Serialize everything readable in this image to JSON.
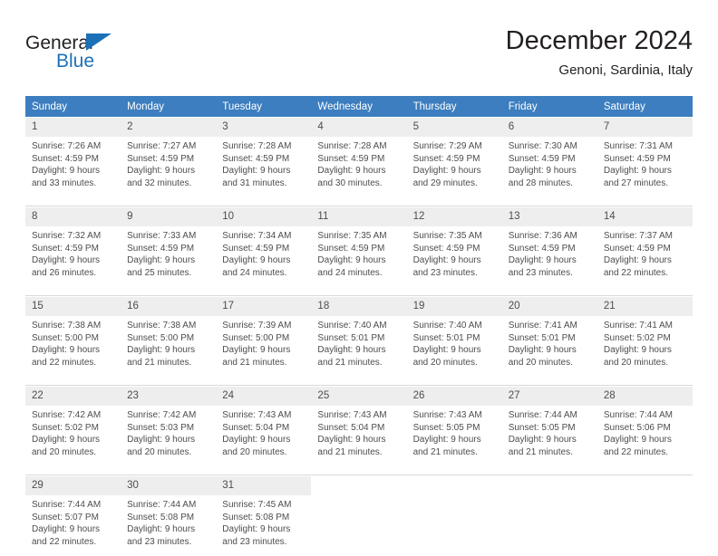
{
  "logo": {
    "word1": "General",
    "word2": "Blue",
    "triangle_color": "#1c70b8",
    "text_color": "#231f20"
  },
  "header": {
    "title": "December 2024",
    "subtitle": "Genoni, Sardinia, Italy"
  },
  "calendar": {
    "header_bg": "#3c7ebf",
    "header_text_color": "#ffffff",
    "daynum_bg": "#eeeeee",
    "weekdays": [
      "Sunday",
      "Monday",
      "Tuesday",
      "Wednesday",
      "Thursday",
      "Friday",
      "Saturday"
    ],
    "weeks": [
      [
        {
          "day": "1",
          "sunrise": "Sunrise: 7:26 AM",
          "sunset": "Sunset: 4:59 PM",
          "daylight1": "Daylight: 9 hours",
          "daylight2": "and 33 minutes."
        },
        {
          "day": "2",
          "sunrise": "Sunrise: 7:27 AM",
          "sunset": "Sunset: 4:59 PM",
          "daylight1": "Daylight: 9 hours",
          "daylight2": "and 32 minutes."
        },
        {
          "day": "3",
          "sunrise": "Sunrise: 7:28 AM",
          "sunset": "Sunset: 4:59 PM",
          "daylight1": "Daylight: 9 hours",
          "daylight2": "and 31 minutes."
        },
        {
          "day": "4",
          "sunrise": "Sunrise: 7:28 AM",
          "sunset": "Sunset: 4:59 PM",
          "daylight1": "Daylight: 9 hours",
          "daylight2": "and 30 minutes."
        },
        {
          "day": "5",
          "sunrise": "Sunrise: 7:29 AM",
          "sunset": "Sunset: 4:59 PM",
          "daylight1": "Daylight: 9 hours",
          "daylight2": "and 29 minutes."
        },
        {
          "day": "6",
          "sunrise": "Sunrise: 7:30 AM",
          "sunset": "Sunset: 4:59 PM",
          "daylight1": "Daylight: 9 hours",
          "daylight2": "and 28 minutes."
        },
        {
          "day": "7",
          "sunrise": "Sunrise: 7:31 AM",
          "sunset": "Sunset: 4:59 PM",
          "daylight1": "Daylight: 9 hours",
          "daylight2": "and 27 minutes."
        }
      ],
      [
        {
          "day": "8",
          "sunrise": "Sunrise: 7:32 AM",
          "sunset": "Sunset: 4:59 PM",
          "daylight1": "Daylight: 9 hours",
          "daylight2": "and 26 minutes."
        },
        {
          "day": "9",
          "sunrise": "Sunrise: 7:33 AM",
          "sunset": "Sunset: 4:59 PM",
          "daylight1": "Daylight: 9 hours",
          "daylight2": "and 25 minutes."
        },
        {
          "day": "10",
          "sunrise": "Sunrise: 7:34 AM",
          "sunset": "Sunset: 4:59 PM",
          "daylight1": "Daylight: 9 hours",
          "daylight2": "and 24 minutes."
        },
        {
          "day": "11",
          "sunrise": "Sunrise: 7:35 AM",
          "sunset": "Sunset: 4:59 PM",
          "daylight1": "Daylight: 9 hours",
          "daylight2": "and 24 minutes."
        },
        {
          "day": "12",
          "sunrise": "Sunrise: 7:35 AM",
          "sunset": "Sunset: 4:59 PM",
          "daylight1": "Daylight: 9 hours",
          "daylight2": "and 23 minutes."
        },
        {
          "day": "13",
          "sunrise": "Sunrise: 7:36 AM",
          "sunset": "Sunset: 4:59 PM",
          "daylight1": "Daylight: 9 hours",
          "daylight2": "and 23 minutes."
        },
        {
          "day": "14",
          "sunrise": "Sunrise: 7:37 AM",
          "sunset": "Sunset: 4:59 PM",
          "daylight1": "Daylight: 9 hours",
          "daylight2": "and 22 minutes."
        }
      ],
      [
        {
          "day": "15",
          "sunrise": "Sunrise: 7:38 AM",
          "sunset": "Sunset: 5:00 PM",
          "daylight1": "Daylight: 9 hours",
          "daylight2": "and 22 minutes."
        },
        {
          "day": "16",
          "sunrise": "Sunrise: 7:38 AM",
          "sunset": "Sunset: 5:00 PM",
          "daylight1": "Daylight: 9 hours",
          "daylight2": "and 21 minutes."
        },
        {
          "day": "17",
          "sunrise": "Sunrise: 7:39 AM",
          "sunset": "Sunset: 5:00 PM",
          "daylight1": "Daylight: 9 hours",
          "daylight2": "and 21 minutes."
        },
        {
          "day": "18",
          "sunrise": "Sunrise: 7:40 AM",
          "sunset": "Sunset: 5:01 PM",
          "daylight1": "Daylight: 9 hours",
          "daylight2": "and 21 minutes."
        },
        {
          "day": "19",
          "sunrise": "Sunrise: 7:40 AM",
          "sunset": "Sunset: 5:01 PM",
          "daylight1": "Daylight: 9 hours",
          "daylight2": "and 20 minutes."
        },
        {
          "day": "20",
          "sunrise": "Sunrise: 7:41 AM",
          "sunset": "Sunset: 5:01 PM",
          "daylight1": "Daylight: 9 hours",
          "daylight2": "and 20 minutes."
        },
        {
          "day": "21",
          "sunrise": "Sunrise: 7:41 AM",
          "sunset": "Sunset: 5:02 PM",
          "daylight1": "Daylight: 9 hours",
          "daylight2": "and 20 minutes."
        }
      ],
      [
        {
          "day": "22",
          "sunrise": "Sunrise: 7:42 AM",
          "sunset": "Sunset: 5:02 PM",
          "daylight1": "Daylight: 9 hours",
          "daylight2": "and 20 minutes."
        },
        {
          "day": "23",
          "sunrise": "Sunrise: 7:42 AM",
          "sunset": "Sunset: 5:03 PM",
          "daylight1": "Daylight: 9 hours",
          "daylight2": "and 20 minutes."
        },
        {
          "day": "24",
          "sunrise": "Sunrise: 7:43 AM",
          "sunset": "Sunset: 5:04 PM",
          "daylight1": "Daylight: 9 hours",
          "daylight2": "and 20 minutes."
        },
        {
          "day": "25",
          "sunrise": "Sunrise: 7:43 AM",
          "sunset": "Sunset: 5:04 PM",
          "daylight1": "Daylight: 9 hours",
          "daylight2": "and 21 minutes."
        },
        {
          "day": "26",
          "sunrise": "Sunrise: 7:43 AM",
          "sunset": "Sunset: 5:05 PM",
          "daylight1": "Daylight: 9 hours",
          "daylight2": "and 21 minutes."
        },
        {
          "day": "27",
          "sunrise": "Sunrise: 7:44 AM",
          "sunset": "Sunset: 5:05 PM",
          "daylight1": "Daylight: 9 hours",
          "daylight2": "and 21 minutes."
        },
        {
          "day": "28",
          "sunrise": "Sunrise: 7:44 AM",
          "sunset": "Sunset: 5:06 PM",
          "daylight1": "Daylight: 9 hours",
          "daylight2": "and 22 minutes."
        }
      ],
      [
        {
          "day": "29",
          "sunrise": "Sunrise: 7:44 AM",
          "sunset": "Sunset: 5:07 PM",
          "daylight1": "Daylight: 9 hours",
          "daylight2": "and 22 minutes."
        },
        {
          "day": "30",
          "sunrise": "Sunrise: 7:44 AM",
          "sunset": "Sunset: 5:08 PM",
          "daylight1": "Daylight: 9 hours",
          "daylight2": "and 23 minutes."
        },
        {
          "day": "31",
          "sunrise": "Sunrise: 7:45 AM",
          "sunset": "Sunset: 5:08 PM",
          "daylight1": "Daylight: 9 hours",
          "daylight2": "and 23 minutes."
        },
        {
          "day": "",
          "sunrise": "",
          "sunset": "",
          "daylight1": "",
          "daylight2": ""
        },
        {
          "day": "",
          "sunrise": "",
          "sunset": "",
          "daylight1": "",
          "daylight2": ""
        },
        {
          "day": "",
          "sunrise": "",
          "sunset": "",
          "daylight1": "",
          "daylight2": ""
        },
        {
          "day": "",
          "sunrise": "",
          "sunset": "",
          "daylight1": "",
          "daylight2": ""
        }
      ]
    ]
  }
}
